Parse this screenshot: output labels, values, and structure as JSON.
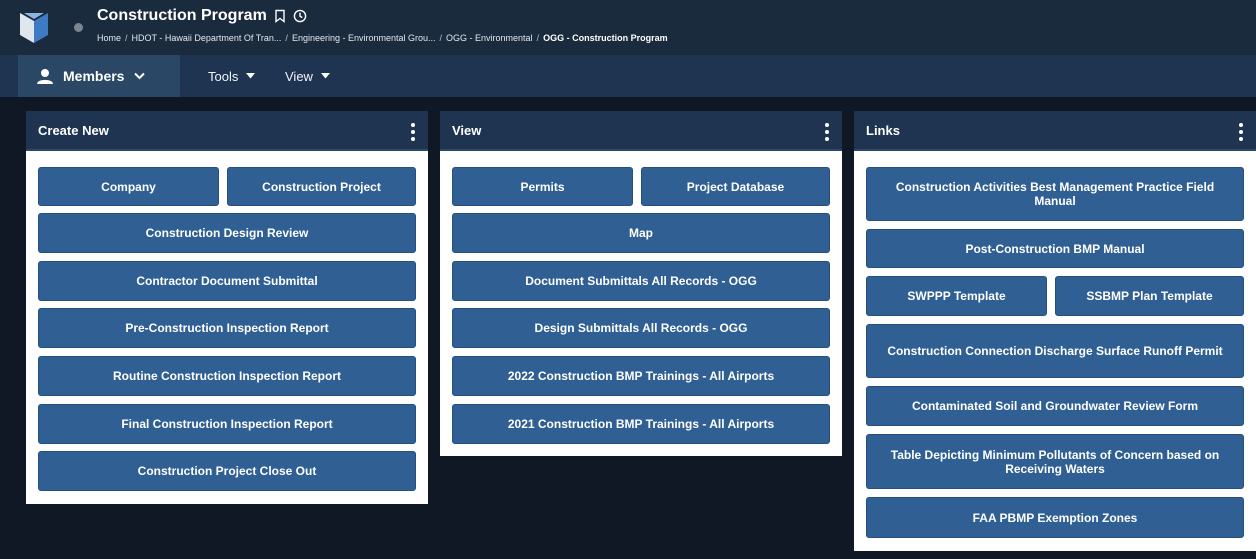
{
  "header": {
    "title": "Construction Program",
    "breadcrumb": [
      "Home",
      "HDOT - Hawaii Department Of Tran...",
      "Engineering - Environmental Grou...",
      "OGG - Environmental",
      "OGG - Construction Program"
    ],
    "separator": "/"
  },
  "menubar": {
    "members_label": "Members",
    "tools_label": "Tools",
    "view_label": "View"
  },
  "panels": {
    "create_new": {
      "title": "Create New",
      "buttons": [
        "Company",
        "Construction Project",
        "Construction Design Review",
        "Contractor Document Submittal",
        "Pre-Construction Inspection Report",
        "Routine Construction Inspection Report",
        "Final Construction Inspection Report",
        "Construction Project Close Out"
      ]
    },
    "view": {
      "title": "View",
      "buttons": [
        "Permits",
        "Project Database",
        "Map",
        "Document Submittals All Records - OGG",
        "Design Submittals All Records - OGG",
        "2022 Construction BMP Trainings - All Airports",
        "2021 Construction BMP Trainings - All Airports"
      ]
    },
    "links": {
      "title": "Links",
      "buttons": [
        "Construction Activities Best Management Practice Field Manual",
        "Post-Construction BMP Manual",
        "SWPPP Template",
        "SSBMP Plan Template",
        "Construction Connection Discharge Surface Runoff Permit",
        "Contaminated Soil and Groundwater Review Form",
        "Table Depicting Minimum Pollutants of Concern based on Receiving Waters",
        "FAA PBMP Exemption Zones"
      ]
    }
  },
  "colors": {
    "topbar": "#1b2b3e",
    "menubar": "#1e3450",
    "button": "#2f5f93",
    "background": "#0f1824"
  }
}
